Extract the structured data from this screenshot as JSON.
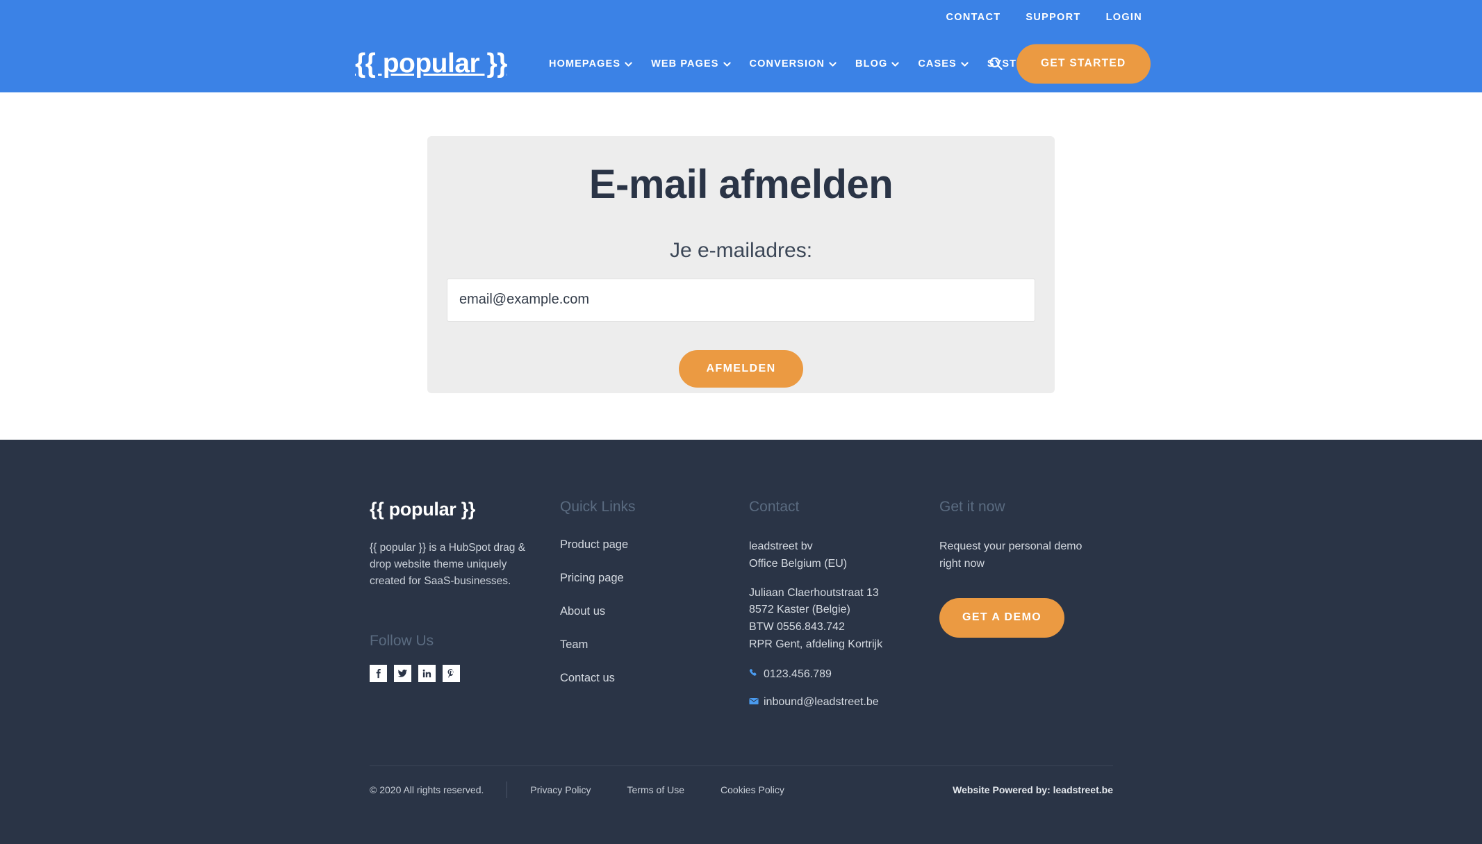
{
  "header": {
    "logo": "{{ popular }}",
    "utility_nav": [
      {
        "label": "CONTACT"
      },
      {
        "label": "SUPPORT"
      },
      {
        "label": "LOGIN"
      }
    ],
    "main_nav": [
      {
        "label": "HOMEPAGES",
        "has_dropdown": true
      },
      {
        "label": "WEB PAGES",
        "has_dropdown": true
      },
      {
        "label": "CONVERSION",
        "has_dropdown": true
      },
      {
        "label": "BLOG",
        "has_dropdown": true
      },
      {
        "label": "CASES",
        "has_dropdown": true
      },
      {
        "label": "SYSTEM",
        "has_dropdown": true
      }
    ],
    "search_icon": "search-icon",
    "cta_label": "GET STARTED",
    "background_color": "#3B82E6",
    "accent_color": "#EB9A42"
  },
  "main": {
    "card": {
      "title": "E-mail afmelden",
      "field_label": "Je e-mailadres:",
      "email_placeholder": "email@example.com",
      "email_value": "",
      "submit_label": "AFMELDEN",
      "background_color": "#EDEDED"
    }
  },
  "footer": {
    "brand": {
      "logo": "{{ popular }}",
      "description": "{{ popular }} is a HubSpot drag & drop website theme uniquely created for SaaS-businesses.",
      "follow_heading": "Follow Us",
      "social": [
        {
          "name": "facebook-icon",
          "glyph": "f"
        },
        {
          "name": "twitter-icon",
          "glyph": "t"
        },
        {
          "name": "linkedin-icon",
          "glyph": "in"
        },
        {
          "name": "pinterest-icon",
          "glyph": "P"
        }
      ]
    },
    "quick_links": {
      "heading": "Quick Links",
      "items": [
        {
          "label": "Product page"
        },
        {
          "label": "Pricing page"
        },
        {
          "label": "About us"
        },
        {
          "label": "Team"
        },
        {
          "label": "Contact us"
        }
      ]
    },
    "contact": {
      "heading": "Contact",
      "company": "leadstreet bv",
      "office": "Office Belgium (EU)",
      "street": "Juliaan Claerhoutstraat 13",
      "city": "8572 Kaster (Belgie)",
      "vat": "BTW 0556.843.742",
      "registry": "RPR Gent, afdeling Kortrijk",
      "phone": "0123.456.789",
      "email": "inbound@leadstreet.be",
      "phone_icon": "phone-icon",
      "email_icon": "envelope-icon"
    },
    "demo": {
      "heading": "Get it now",
      "text": "Request your personal demo right now",
      "button_label": "GET A DEMO"
    },
    "bottom": {
      "copyright": "© 2020 All rights reserved.",
      "links": [
        {
          "label": "Privacy Policy"
        },
        {
          "label": "Terms of Use"
        },
        {
          "label": "Cookies Policy"
        }
      ],
      "powered_by": "Website Powered by: leadstreet.be"
    },
    "background_color": "#2A3446",
    "heading_color": "#5A6B80"
  }
}
